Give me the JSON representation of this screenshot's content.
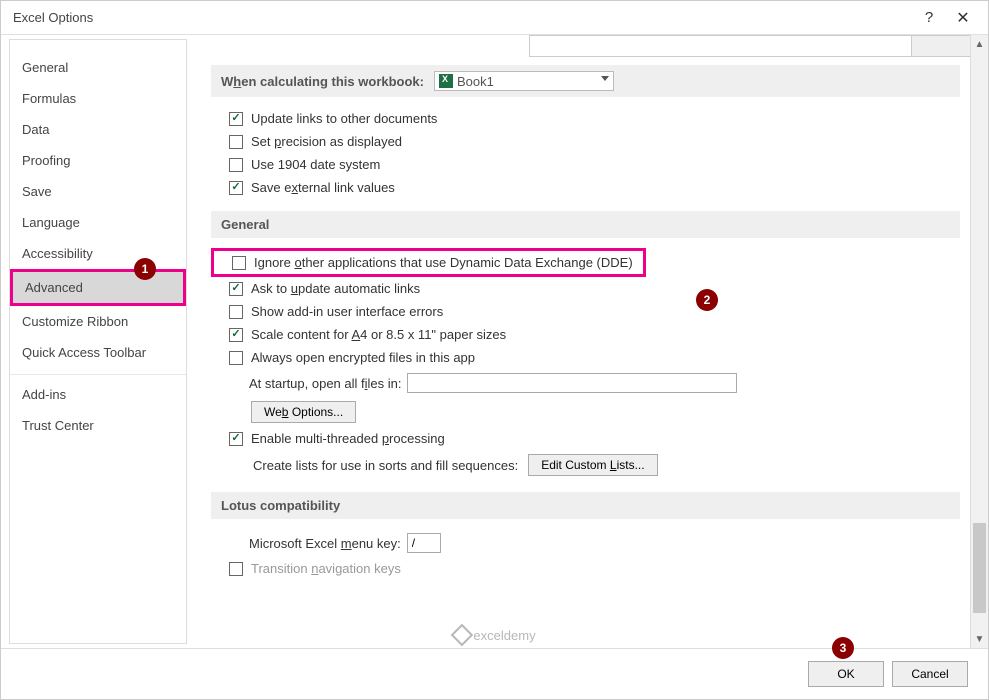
{
  "dialog": {
    "title": "Excel Options"
  },
  "sidebar": {
    "items": [
      {
        "label": "General"
      },
      {
        "label": "Formulas"
      },
      {
        "label": "Data"
      },
      {
        "label": "Proofing"
      },
      {
        "label": "Save"
      },
      {
        "label": "Language"
      },
      {
        "label": "Accessibility"
      },
      {
        "label": "Advanced"
      },
      {
        "label": "Customize Ribbon"
      },
      {
        "label": "Quick Access Toolbar"
      },
      {
        "label": "Add-ins"
      },
      {
        "label": "Trust Center"
      }
    ]
  },
  "sections": {
    "calc": {
      "title_pre": "W",
      "title_u": "h",
      "title_post": "en calculating this workbook:",
      "workbook": "Book1",
      "opts": {
        "update_links": "Update links to other documents",
        "set_precision_pre": "Set ",
        "set_precision_u": "p",
        "set_precision_post": "recision as displayed",
        "date1904": "Use 1904 date system",
        "ext_links_pre": "Save e",
        "ext_links_u": "x",
        "ext_links_post": "ternal link values"
      }
    },
    "general": {
      "title": "General",
      "ignore_dde_pre": "Ignore ",
      "ignore_dde_u": "o",
      "ignore_dde_post": "ther applications that use Dynamic Data Exchange (DDE)",
      "ask_update_pre": "Ask to ",
      "ask_update_u": "u",
      "ask_update_post": "pdate automatic links",
      "show_addin": "Show add-in user interface errors",
      "scale_pre": "Scale content for ",
      "scale_u": "A",
      "scale_post": "4 or 8.5 x 11\" paper sizes",
      "encrypted": "Always open encrypted files in this app",
      "startup_pre": "At startup, open all f",
      "startup_u": "i",
      "startup_post": "les in:",
      "startup_value": "",
      "web_options": "Web Options...",
      "multithread_pre": "Enable multi-threaded ",
      "multithread_u": "p",
      "multithread_post": "rocessing",
      "create_lists": "Create lists for use in sorts and fill sequences:",
      "edit_lists_pre": "Edit Custom ",
      "edit_lists_u": "L",
      "edit_lists_post": "ists..."
    },
    "lotus": {
      "title": "Lotus compatibility",
      "menu_key_pre": "Microsoft Excel ",
      "menu_key_u": "m",
      "menu_key_post": "enu key:",
      "menu_key_value": "/",
      "transition_pre": "Transition ",
      "transition_u": "n",
      "transition_post": "avigation keys"
    }
  },
  "footer": {
    "ok": "OK",
    "cancel": "Cancel"
  },
  "watermark": "exceldemy"
}
